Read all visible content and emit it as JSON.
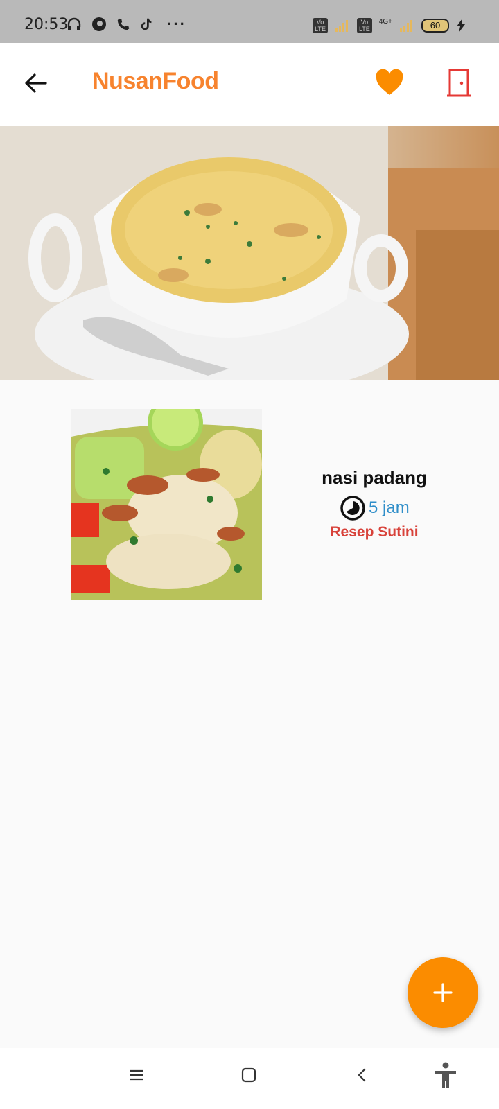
{
  "status_bar": {
    "time": "20:53",
    "volte_1": "Vo\nLTE",
    "volte_2": "Vo\nLTE",
    "network": "4G+",
    "battery": "60",
    "more": "···"
  },
  "app_bar": {
    "title": "NusanFood",
    "title_color": "#f7832e",
    "heart_color": "#fb8c00",
    "logout_color": "#e53935"
  },
  "recipe": {
    "name": "nasi padang",
    "duration": "5 jam",
    "author": "Resep Sutini",
    "duration_color": "#2f8ec9",
    "author_color": "#d8423a"
  },
  "fab": {
    "label": "+",
    "color": "#fb8c00"
  },
  "icons": {
    "back": "arrow-left-icon",
    "favorite": "heart-icon",
    "logout": "door-icon",
    "timer": "timer-icon",
    "menu": "menu-icon",
    "home": "square-icon",
    "nav_back": "chevron-left-icon",
    "accessibility": "accessibility-icon"
  }
}
